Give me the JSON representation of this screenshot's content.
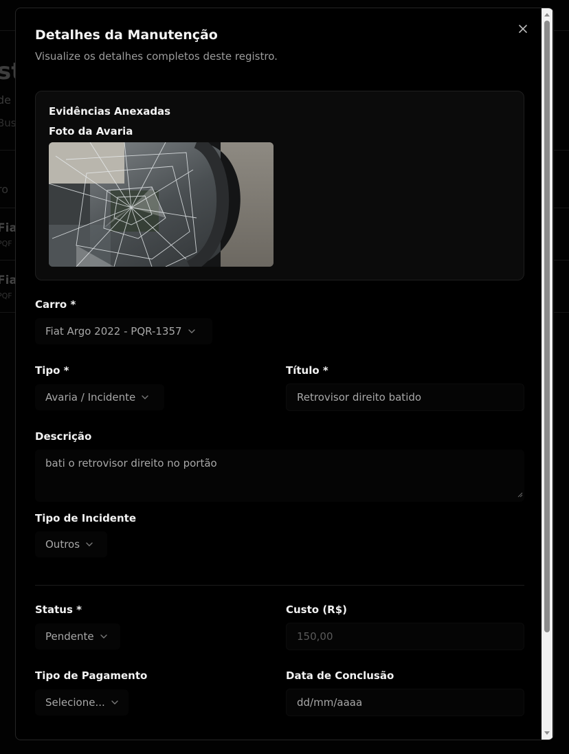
{
  "background": {
    "heading_fragment": "st",
    "sub_fragment_1": "de r",
    "sub_fragment_2": "Busc",
    "col_fragment": "ro",
    "row1_title": "Fia",
    "row1_plate": "PQF",
    "row2_title": "Fia",
    "row2_plate": "PQF"
  },
  "modal": {
    "title": "Detalhes da Manutenção",
    "subtitle": "Visualize os detalhes completos deste registro.",
    "evidence": {
      "title": "Evidências Anexadas",
      "photo_label": "Foto da Avaria"
    },
    "fields": {
      "car": {
        "label": "Carro *",
        "value": "Fiat Argo 2022 - PQR-1357"
      },
      "type": {
        "label": "Tipo *",
        "value": "Avaria / Incidente"
      },
      "title": {
        "label": "Título *",
        "value": "Retrovisor direito batido"
      },
      "description": {
        "label": "Descrição",
        "value": "bati o retrovisor direito no portão"
      },
      "incident_type": {
        "label": "Tipo de Incidente",
        "value": "Outros"
      },
      "status": {
        "label": "Status *",
        "value": "Pendente"
      },
      "cost": {
        "label": "Custo (R$)",
        "placeholder": "150,00"
      },
      "payment_type": {
        "label": "Tipo de Pagamento",
        "value": "Selecione..."
      },
      "completion_date": {
        "label": "Data de Conclusão",
        "placeholder": "dd/mm/aaaa"
      }
    }
  },
  "icons": {
    "close": "close-icon",
    "chevron": "chevron-down-icon",
    "resize": "resize-handle-icon"
  },
  "colors": {
    "modal_bg": "#000000",
    "card_bg": "#0b0b0b",
    "field_bg": "#050505",
    "text_primary": "#f2f2f2",
    "text_muted": "#a8a8a8"
  }
}
